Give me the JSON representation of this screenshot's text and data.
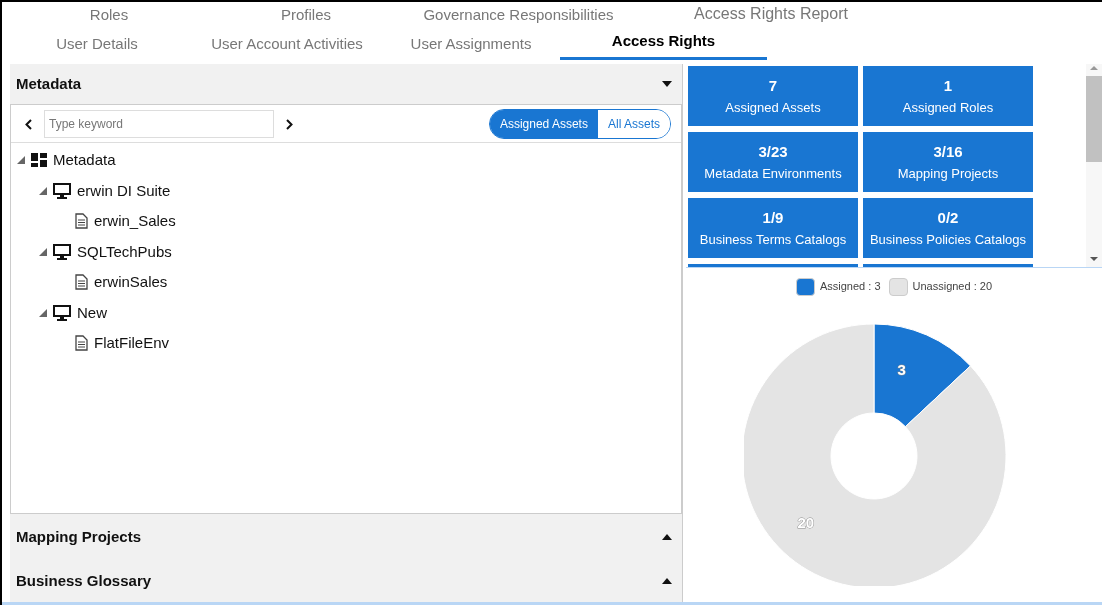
{
  "tab_rows": [
    {
      "tabs": [
        {
          "label": "Roles",
          "selected": false
        },
        {
          "label": "Profiles",
          "selected": false
        },
        {
          "label": "Governance Responsibilities",
          "selected": false
        },
        {
          "label": "Access Rights Report",
          "selected": false
        }
      ]
    },
    {
      "tabs": [
        {
          "label": "User Details",
          "selected": false
        },
        {
          "label": "User Account Activities",
          "selected": false
        },
        {
          "label": "User Assignments",
          "selected": false
        },
        {
          "label": "Access Rights",
          "selected": true
        }
      ]
    }
  ],
  "sections": [
    {
      "title": "Metadata",
      "expanded": true,
      "search": {
        "placeholder": "Type keyword"
      },
      "filters": [
        {
          "label": "Assigned Assets",
          "selected": true
        },
        {
          "label": "All Assets",
          "selected": false
        }
      ],
      "tree": [
        {
          "label": "Metadata",
          "kind": "root",
          "expanded": true,
          "children": [
            {
              "label": "erwin DI Suite",
              "kind": "environment",
              "expanded": true,
              "children": [
                {
                  "label": "erwin_Sales",
                  "kind": "file"
                }
              ]
            },
            {
              "label": "SQLTechPubs",
              "kind": "environment",
              "expanded": true,
              "children": [
                {
                  "label": "erwinSales",
                  "kind": "file"
                }
              ]
            },
            {
              "label": "New",
              "kind": "environment",
              "expanded": true,
              "children": [
                {
                  "label": "FlatFileEnv",
                  "kind": "file"
                }
              ]
            }
          ]
        }
      ]
    },
    {
      "title": "Mapping Projects",
      "expanded": false
    },
    {
      "title": "Business Glossary",
      "expanded": false
    }
  ],
  "tiles": [
    {
      "value": "7",
      "label": "Assigned Assets"
    },
    {
      "value": "1",
      "label": "Assigned Roles"
    },
    {
      "value": "3/23",
      "label": "Metadata Environments"
    },
    {
      "value": "3/16",
      "label": "Mapping Projects"
    },
    {
      "value": "1/9",
      "label": "Business Terms Catalogs"
    },
    {
      "value": "0/2",
      "label": "Business Policies Catalogs"
    }
  ],
  "chart_data": {
    "type": "donut",
    "categories": [
      "Assigned : 3",
      "Unassigned : 20"
    ],
    "values": [
      3,
      20
    ],
    "colors": [
      "#1976d2",
      "#e4e4e4"
    ],
    "data_labels": true
  }
}
